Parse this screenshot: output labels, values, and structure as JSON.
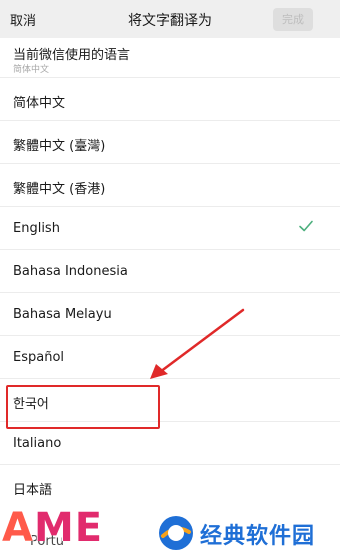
{
  "header": {
    "cancel": "取消",
    "title": "将文字翻译为",
    "done": "完成"
  },
  "languages": [
    {
      "label": "当前微信使用的语言",
      "sub": "简体中文"
    },
    {
      "label": "简体中文"
    },
    {
      "label": "繁體中文 (臺灣)"
    },
    {
      "label": "繁體中文 (香港)"
    },
    {
      "label": "English",
      "selected": true
    },
    {
      "label": "Bahasa Indonesia"
    },
    {
      "label": "Bahasa Melayu"
    },
    {
      "label": "Español"
    },
    {
      "label": "한국어"
    },
    {
      "label": "Italiano"
    },
    {
      "label": "日本語"
    }
  ],
  "partial_item": "Portu",
  "watermark": {
    "left_a": "A",
    "left_me": "ME",
    "right_text": "经典软件园"
  },
  "colors": {
    "highlight": "#e02929",
    "check": "#4caf7d",
    "watermark_blue": "#1f6fd6"
  }
}
